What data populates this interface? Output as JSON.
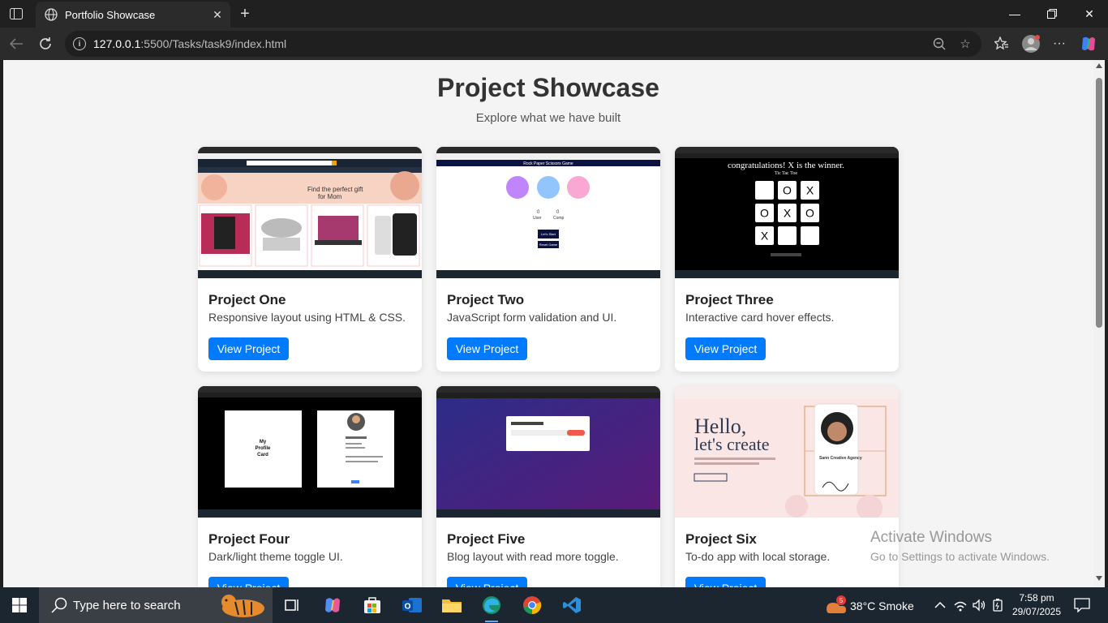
{
  "browser": {
    "tab_title": "Portfolio Showcase",
    "url_host": "127.0.0.1",
    "url_path": ":5500/Tasks/task9/index.html"
  },
  "page": {
    "title": "Project Showcase",
    "subtitle": "Explore what we have built",
    "projects": [
      {
        "title": "Project One",
        "desc": "Responsive layout using HTML & CSS.",
        "button": "View Project",
        "thumb": {
          "banner_line1": "Find the perfect gift",
          "banner_line2": "for Mom"
        }
      },
      {
        "title": "Project Two",
        "desc": "JavaScript form validation and UI.",
        "button": "View Project",
        "thumb": {
          "header": "Rock Paper Scissors Game",
          "score_left": "0",
          "score_right": "0",
          "label_left": "User",
          "label_right": "Comp",
          "btn1": "Let's Start",
          "btn2": "Reset Game"
        }
      },
      {
        "title": "Project Three",
        "desc": "Interactive card hover effects.",
        "button": "View Project",
        "thumb": {
          "headline": "congratulations! X is the winner.",
          "sub": "Tic Tac Toe",
          "cells": [
            "",
            "O",
            "X",
            "O",
            "X",
            "O",
            "X",
            "",
            ""
          ]
        }
      },
      {
        "title": "Project Four",
        "desc": "Dark/light theme toggle UI.",
        "button": "View Project",
        "thumb": {
          "card_line1": "My",
          "card_line2": "Profile",
          "card_line3": "Card"
        }
      },
      {
        "title": "Project Five",
        "desc": "Blog layout with read more toggle.",
        "button": "View Project",
        "thumb": {}
      },
      {
        "title": "Project Six",
        "desc": "To-do app with local storage.",
        "button": "View Project",
        "thumb": {
          "hero_line1": "Hello,",
          "hero_line2": "let's create",
          "agency": "Sann Creative Agency"
        }
      }
    ]
  },
  "watermark": {
    "line1": "Activate Windows",
    "line2": "Go to Settings to activate Windows."
  },
  "taskbar": {
    "search_placeholder": "Type here to search",
    "weather_badge": "5",
    "weather": "38°C  Smoke",
    "time": "7:58 pm",
    "date": "29/07/2025"
  },
  "colors": {
    "accent": "#007bff",
    "page_bg": "#f4f4f4",
    "browser_chrome": "#202020"
  }
}
